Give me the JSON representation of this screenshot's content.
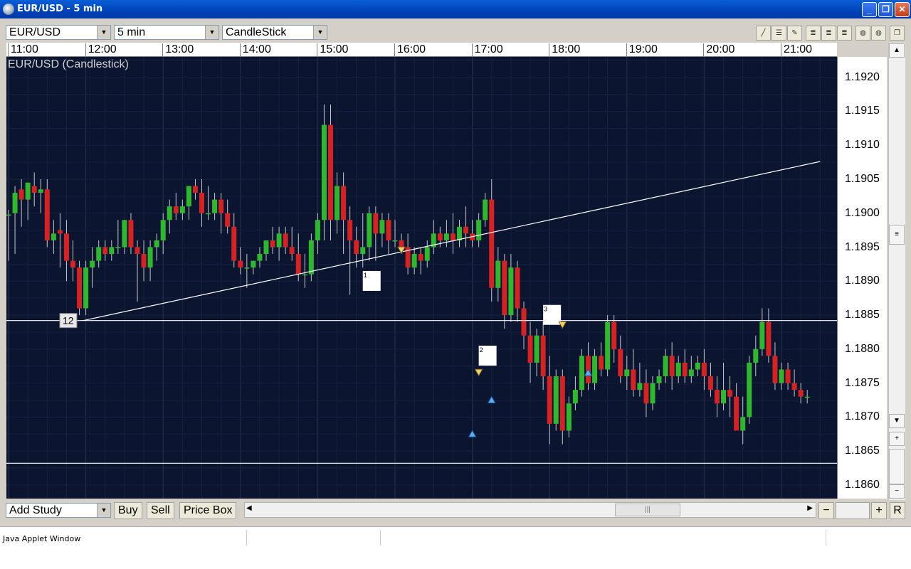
{
  "window": {
    "title": "EUR/USD - 5 min"
  },
  "toolbar": {
    "symbol": "EUR/USD",
    "interval": "5 min",
    "chart_type": "CandleStick"
  },
  "chart": {
    "label": "EUR/USD (Candlestick)",
    "time_labels": [
      "11:00",
      "12:00",
      "13:00",
      "14:00",
      "15:00",
      "16:00",
      "17:00",
      "18:00",
      "19:00",
      "20:00",
      "21:00"
    ],
    "price_labels": [
      "1.1920",
      "1.1915",
      "1.1910",
      "1.1905",
      "1.1900",
      "1.1895",
      "1.1890",
      "1.1885",
      "1.1880",
      "1.1875",
      "1.1870",
      "1.1865",
      "1.1860"
    ],
    "horizontal_levels": [
      1.18842,
      1.18632
    ],
    "trendline": {
      "start_time": "11:58",
      "start_price": 1.18842,
      "end_time": "21:30",
      "end_price": 1.19076
    },
    "level_tag": "12",
    "annotations": [
      {
        "label": "1",
        "time": "15:35",
        "price": 1.18915
      },
      {
        "label": "2",
        "time": "17:05",
        "price": 1.18805
      },
      {
        "label": "3",
        "time": "17:55",
        "price": 1.18865
      }
    ],
    "colors": {
      "background": "#0b1530",
      "up": "#2eb82e",
      "down": "#d62222",
      "line": "#ffffff",
      "sell_marker": "#f2d36b",
      "buy_marker": "#5ab0ff"
    }
  },
  "chart_data": {
    "type": "candlestick",
    "title": "EUR/USD (Candlestick)",
    "interval": "5 min",
    "x_range": [
      "11:00",
      "21:30"
    ],
    "ylim": [
      1.1858,
      1.1923
    ],
    "grid": true,
    "bars": [
      {
        "t": "11:00",
        "o": 1.18998,
        "h": 1.19005,
        "c": 1.18998,
        "l": 1.1893
      },
      {
        "t": "11:05",
        "o": 1.19,
        "h": 1.1904,
        "c": 1.1903,
        "l": 1.1894
      },
      {
        "t": "11:10",
        "o": 1.19035,
        "h": 1.1905,
        "c": 1.1902,
        "l": 1.1898
      },
      {
        "t": "11:15",
        "o": 1.1902,
        "h": 1.19045,
        "c": 1.19045,
        "l": 1.1899
      },
      {
        "t": "11:20",
        "o": 1.1904,
        "h": 1.1906,
        "c": 1.1903,
        "l": 1.1901
      },
      {
        "t": "11:25",
        "o": 1.1903,
        "h": 1.1905,
        "c": 1.19035,
        "l": 1.19
      },
      {
        "t": "11:30",
        "o": 1.19035,
        "h": 1.1905,
        "c": 1.1896,
        "l": 1.1895
      },
      {
        "t": "11:35",
        "o": 1.1896,
        "h": 1.1899,
        "c": 1.1897,
        "l": 1.1894
      },
      {
        "t": "11:40",
        "o": 1.18975,
        "h": 1.19,
        "c": 1.1897,
        "l": 1.1892
      },
      {
        "t": "11:45",
        "o": 1.1897,
        "h": 1.1899,
        "c": 1.1893,
        "l": 1.189
      },
      {
        "t": "11:50",
        "o": 1.1893,
        "h": 1.1896,
        "c": 1.1892,
        "l": 1.189
      },
      {
        "t": "11:55",
        "o": 1.1892,
        "h": 1.1893,
        "c": 1.1886,
        "l": 1.1885
      },
      {
        "t": "12:00",
        "o": 1.1886,
        "h": 1.1893,
        "c": 1.1892,
        "l": 1.1885
      },
      {
        "t": "12:05",
        "o": 1.1892,
        "h": 1.1895,
        "c": 1.1893,
        "l": 1.1889
      },
      {
        "t": "12:10",
        "o": 1.1893,
        "h": 1.1896,
        "c": 1.1895,
        "l": 1.1892
      },
      {
        "t": "12:15",
        "o": 1.1895,
        "h": 1.1896,
        "c": 1.1894,
        "l": 1.1893
      },
      {
        "t": "12:20",
        "o": 1.1894,
        "h": 1.1896,
        "c": 1.1895,
        "l": 1.1893
      },
      {
        "t": "12:25",
        "o": 1.1895,
        "h": 1.1899,
        "c": 1.1895,
        "l": 1.1894
      },
      {
        "t": "12:30",
        "o": 1.1895,
        "h": 1.1899,
        "c": 1.1899,
        "l": 1.1894
      },
      {
        "t": "12:35",
        "o": 1.1899,
        "h": 1.19,
        "c": 1.1895,
        "l": 1.1894
      },
      {
        "t": "12:40",
        "o": 1.1895,
        "h": 1.1896,
        "c": 1.1894,
        "l": 1.1887
      },
      {
        "t": "12:45",
        "o": 1.1894,
        "h": 1.1896,
        "c": 1.1892,
        "l": 1.189
      },
      {
        "t": "12:50",
        "o": 1.1892,
        "h": 1.1896,
        "c": 1.1895,
        "l": 1.189
      },
      {
        "t": "12:55",
        "o": 1.1895,
        "h": 1.1897,
        "c": 1.1896,
        "l": 1.1893
      },
      {
        "t": "13:00",
        "o": 1.1896,
        "h": 1.19,
        "c": 1.1899,
        "l": 1.1894
      },
      {
        "t": "13:05",
        "o": 1.1899,
        "h": 1.1902,
        "c": 1.1901,
        "l": 1.1897
      },
      {
        "t": "13:10",
        "o": 1.1901,
        "h": 1.1903,
        "c": 1.19,
        "l": 1.1899
      },
      {
        "t": "13:15",
        "o": 1.19,
        "h": 1.1902,
        "c": 1.1901,
        "l": 1.1899
      },
      {
        "t": "13:20",
        "o": 1.1901,
        "h": 1.1904,
        "c": 1.1904,
        "l": 1.1899
      },
      {
        "t": "13:25",
        "o": 1.1904,
        "h": 1.1905,
        "c": 1.1903,
        "l": 1.1902
      },
      {
        "t": "13:30",
        "o": 1.1903,
        "h": 1.1905,
        "c": 1.19,
        "l": 1.1898
      },
      {
        "t": "13:35",
        "o": 1.19,
        "h": 1.1904,
        "c": 1.19,
        "l": 1.1899
      },
      {
        "t": "13:40",
        "o": 1.19,
        "h": 1.1903,
        "c": 1.1902,
        "l": 1.1899
      },
      {
        "t": "13:45",
        "o": 1.1902,
        "h": 1.1903,
        "c": 1.19,
        "l": 1.1897
      },
      {
        "t": "13:50",
        "o": 1.19,
        "h": 1.1902,
        "c": 1.1898,
        "l": 1.1897
      },
      {
        "t": "13:55",
        "o": 1.1898,
        "h": 1.19,
        "c": 1.1893,
        "l": 1.1892
      },
      {
        "t": "14:00",
        "o": 1.1893,
        "h": 1.1895,
        "c": 1.1892,
        "l": 1.1891
      },
      {
        "t": "14:05",
        "o": 1.1892,
        "h": 1.1894,
        "c": 1.1892,
        "l": 1.1889
      },
      {
        "t": "14:10",
        "o": 1.1892,
        "h": 1.1893,
        "c": 1.1893,
        "l": 1.1891
      },
      {
        "t": "14:15",
        "o": 1.1893,
        "h": 1.1895,
        "c": 1.1894,
        "l": 1.1892
      },
      {
        "t": "14:20",
        "o": 1.1894,
        "h": 1.1896,
        "c": 1.1896,
        "l": 1.1893
      },
      {
        "t": "14:25",
        "o": 1.1896,
        "h": 1.1898,
        "c": 1.1895,
        "l": 1.1894
      },
      {
        "t": "14:30",
        "o": 1.1895,
        "h": 1.1898,
        "c": 1.1897,
        "l": 1.1893
      },
      {
        "t": "14:35",
        "o": 1.1897,
        "h": 1.1898,
        "c": 1.1895,
        "l": 1.1894
      },
      {
        "t": "14:40",
        "o": 1.1895,
        "h": 1.1898,
        "c": 1.1894,
        "l": 1.1893
      },
      {
        "t": "14:45",
        "o": 1.1894,
        "h": 1.1897,
        "c": 1.1891,
        "l": 1.189
      },
      {
        "t": "14:50",
        "o": 1.1891,
        "h": 1.1894,
        "c": 1.1891,
        "l": 1.1889
      },
      {
        "t": "14:55",
        "o": 1.1891,
        "h": 1.1897,
        "c": 1.1896,
        "l": 1.189
      },
      {
        "t": "15:00",
        "o": 1.1896,
        "h": 1.19,
        "c": 1.1899,
        "l": 1.1894
      },
      {
        "t": "15:05",
        "o": 1.1899,
        "h": 1.1916,
        "c": 1.1913,
        "l": 1.1896
      },
      {
        "t": "15:10",
        "o": 1.1913,
        "h": 1.1916,
        "c": 1.1899,
        "l": 1.1896
      },
      {
        "t": "15:15",
        "o": 1.1899,
        "h": 1.1906,
        "c": 1.1904,
        "l": 1.1897
      },
      {
        "t": "15:20",
        "o": 1.1904,
        "h": 1.1906,
        "c": 1.1899,
        "l": 1.1894
      },
      {
        "t": "15:25",
        "o": 1.1899,
        "h": 1.1901,
        "c": 1.1896,
        "l": 1.1888
      },
      {
        "t": "15:30",
        "o": 1.1896,
        "h": 1.1898,
        "c": 1.1894,
        "l": 1.1892
      },
      {
        "t": "15:35",
        "o": 1.1894,
        "h": 1.19,
        "c": 1.1895,
        "l": 1.1892
      },
      {
        "t": "15:40",
        "o": 1.1895,
        "h": 1.1901,
        "c": 1.19,
        "l": 1.1893
      },
      {
        "t": "15:45",
        "o": 1.19,
        "h": 1.1901,
        "c": 1.1897,
        "l": 1.1893
      },
      {
        "t": "15:50",
        "o": 1.1897,
        "h": 1.19,
        "c": 1.1899,
        "l": 1.1895
      },
      {
        "t": "15:55",
        "o": 1.1899,
        "h": 1.19,
        "c": 1.1896,
        "l": 1.1894
      },
      {
        "t": "16:00",
        "o": 1.1896,
        "h": 1.1899,
        "c": 1.1896,
        "l": 1.1895
      },
      {
        "t": "16:05",
        "o": 1.1896,
        "h": 1.1897,
        "c": 1.1895,
        "l": 1.1894
      },
      {
        "t": "16:10",
        "o": 1.1895,
        "h": 1.1897,
        "c": 1.1892,
        "l": 1.1891
      },
      {
        "t": "16:15",
        "o": 1.1892,
        "h": 1.1895,
        "c": 1.1894,
        "l": 1.1891
      },
      {
        "t": "16:20",
        "o": 1.1894,
        "h": 1.1895,
        "c": 1.1893,
        "l": 1.1891
      },
      {
        "t": "16:25",
        "o": 1.1893,
        "h": 1.1896,
        "c": 1.1895,
        "l": 1.1892
      },
      {
        "t": "16:30",
        "o": 1.1895,
        "h": 1.1899,
        "c": 1.1897,
        "l": 1.1894
      },
      {
        "t": "16:35",
        "o": 1.1897,
        "h": 1.1898,
        "c": 1.1896,
        "l": 1.1895
      },
      {
        "t": "16:40",
        "o": 1.1896,
        "h": 1.1899,
        "c": 1.1897,
        "l": 1.1895
      },
      {
        "t": "16:45",
        "o": 1.1897,
        "h": 1.19,
        "c": 1.1896,
        "l": 1.1894
      },
      {
        "t": "16:50",
        "o": 1.1896,
        "h": 1.1899,
        "c": 1.1898,
        "l": 1.1895
      },
      {
        "t": "16:55",
        "o": 1.1898,
        "h": 1.1901,
        "c": 1.1897,
        "l": 1.1895
      },
      {
        "t": "17:00",
        "o": 1.1897,
        "h": 1.1899,
        "c": 1.1896,
        "l": 1.1895
      },
      {
        "t": "17:05",
        "o": 1.1896,
        "h": 1.19,
        "c": 1.1899,
        "l": 1.1895
      },
      {
        "t": "17:10",
        "o": 1.1899,
        "h": 1.1903,
        "c": 1.1902,
        "l": 1.1898
      },
      {
        "t": "17:15",
        "o": 1.1902,
        "h": 1.1905,
        "c": 1.1889,
        "l": 1.1887
      },
      {
        "t": "17:20",
        "o": 1.1889,
        "h": 1.1895,
        "c": 1.1893,
        "l": 1.1887
      },
      {
        "t": "17:25",
        "o": 1.1893,
        "h": 1.1894,
        "c": 1.1885,
        "l": 1.1883
      },
      {
        "t": "17:30",
        "o": 1.1885,
        "h": 1.1894,
        "c": 1.1892,
        "l": 1.1884
      },
      {
        "t": "17:35",
        "o": 1.1892,
        "h": 1.1893,
        "c": 1.1886,
        "l": 1.1884
      },
      {
        "t": "17:40",
        "o": 1.1886,
        "h": 1.1887,
        "c": 1.1882,
        "l": 1.188
      },
      {
        "t": "17:45",
        "o": 1.1882,
        "h": 1.1884,
        "c": 1.1878,
        "l": 1.1875
      },
      {
        "t": "17:50",
        "o": 1.1878,
        "h": 1.1883,
        "c": 1.1882,
        "l": 1.1876
      },
      {
        "t": "17:55",
        "o": 1.1882,
        "h": 1.1884,
        "c": 1.1876,
        "l": 1.1874
      },
      {
        "t": "18:00",
        "o": 1.1876,
        "h": 1.1879,
        "c": 1.1869,
        "l": 1.1866
      },
      {
        "t": "18:05",
        "o": 1.1869,
        "h": 1.1877,
        "c": 1.1876,
        "l": 1.1868
      },
      {
        "t": "18:10",
        "o": 1.1876,
        "h": 1.1877,
        "c": 1.1868,
        "l": 1.1866
      },
      {
        "t": "18:15",
        "o": 1.1868,
        "h": 1.1873,
        "c": 1.1872,
        "l": 1.1867
      },
      {
        "t": "18:20",
        "o": 1.1872,
        "h": 1.1876,
        "c": 1.1874,
        "l": 1.1871
      },
      {
        "t": "18:25",
        "o": 1.1874,
        "h": 1.188,
        "c": 1.1879,
        "l": 1.1873
      },
      {
        "t": "18:30",
        "o": 1.1879,
        "h": 1.1881,
        "c": 1.1875,
        "l": 1.1874
      },
      {
        "t": "18:35",
        "o": 1.1875,
        "h": 1.188,
        "c": 1.1879,
        "l": 1.1874
      },
      {
        "t": "18:40",
        "o": 1.1879,
        "h": 1.1881,
        "c": 1.1877,
        "l": 1.1876
      },
      {
        "t": "18:45",
        "o": 1.1877,
        "h": 1.1885,
        "c": 1.1884,
        "l": 1.1876
      },
      {
        "t": "18:50",
        "o": 1.1884,
        "h": 1.1885,
        "c": 1.188,
        "l": 1.1878
      },
      {
        "t": "18:55",
        "o": 1.188,
        "h": 1.1882,
        "c": 1.1876,
        "l": 1.1875
      },
      {
        "t": "19:00",
        "o": 1.1876,
        "h": 1.1879,
        "c": 1.1877,
        "l": 1.1874
      },
      {
        "t": "19:05",
        "o": 1.1877,
        "h": 1.188,
        "c": 1.1874,
        "l": 1.1873
      },
      {
        "t": "19:10",
        "o": 1.1874,
        "h": 1.1878,
        "c": 1.1875,
        "l": 1.1873
      },
      {
        "t": "19:15",
        "o": 1.1875,
        "h": 1.1877,
        "c": 1.1872,
        "l": 1.187
      },
      {
        "t": "19:20",
        "o": 1.1872,
        "h": 1.1876,
        "c": 1.1875,
        "l": 1.1871
      },
      {
        "t": "19:25",
        "o": 1.1875,
        "h": 1.1877,
        "c": 1.1876,
        "l": 1.1874
      },
      {
        "t": "19:30",
        "o": 1.1876,
        "h": 1.188,
        "c": 1.1879,
        "l": 1.1875
      },
      {
        "t": "19:35",
        "o": 1.1879,
        "h": 1.1881,
        "c": 1.1876,
        "l": 1.1874
      },
      {
        "t": "19:40",
        "o": 1.1876,
        "h": 1.1879,
        "c": 1.1878,
        "l": 1.1875
      },
      {
        "t": "19:45",
        "o": 1.1878,
        "h": 1.188,
        "c": 1.1876,
        "l": 1.1875
      },
      {
        "t": "19:50",
        "o": 1.1876,
        "h": 1.1879,
        "c": 1.1877,
        "l": 1.1875
      },
      {
        "t": "19:55",
        "o": 1.1877,
        "h": 1.1879,
        "c": 1.1878,
        "l": 1.1876
      },
      {
        "t": "20:00",
        "o": 1.1878,
        "h": 1.188,
        "c": 1.1876,
        "l": 1.1874
      },
      {
        "t": "20:05",
        "o": 1.1876,
        "h": 1.1878,
        "c": 1.1874,
        "l": 1.1873
      },
      {
        "t": "20:10",
        "o": 1.1874,
        "h": 1.1876,
        "c": 1.1872,
        "l": 1.187
      },
      {
        "t": "20:15",
        "o": 1.1872,
        "h": 1.1878,
        "c": 1.1874,
        "l": 1.1871
      },
      {
        "t": "20:20",
        "o": 1.1874,
        "h": 1.1876,
        "c": 1.1873,
        "l": 1.187
      },
      {
        "t": "20:25",
        "o": 1.1873,
        "h": 1.1875,
        "c": 1.1868,
        "l": 1.1868
      },
      {
        "t": "20:30",
        "o": 1.1868,
        "h": 1.1873,
        "c": 1.187,
        "l": 1.1866
      },
      {
        "t": "20:35",
        "o": 1.187,
        "h": 1.1879,
        "c": 1.1878,
        "l": 1.1869
      },
      {
        "t": "20:40",
        "o": 1.1878,
        "h": 1.1882,
        "c": 1.188,
        "l": 1.1876
      },
      {
        "t": "20:45",
        "o": 1.188,
        "h": 1.1886,
        "c": 1.1884,
        "l": 1.1879
      },
      {
        "t": "20:50",
        "o": 1.1884,
        "h": 1.1886,
        "c": 1.1879,
        "l": 1.1878
      },
      {
        "t": "20:55",
        "o": 1.1879,
        "h": 1.1881,
        "c": 1.1875,
        "l": 1.1874
      },
      {
        "t": "21:00",
        "o": 1.1875,
        "h": 1.1878,
        "c": 1.1877,
        "l": 1.1874
      },
      {
        "t": "21:05",
        "o": 1.1877,
        "h": 1.1878,
        "c": 1.1875,
        "l": 1.1874
      },
      {
        "t": "21:10",
        "o": 1.1875,
        "h": 1.1877,
        "c": 1.1874,
        "l": 1.1873
      },
      {
        "t": "21:15",
        "o": 1.1874,
        "h": 1.1875,
        "c": 1.1873,
        "l": 1.1872
      },
      {
        "t": "21:20",
        "o": 1.1873,
        "h": 1.1874,
        "c": 1.1873,
        "l": 1.1872
      }
    ],
    "sell_markers": [
      {
        "t": "16:05",
        "price": 1.18945
      },
      {
        "t": "17:05",
        "price": 1.18765
      },
      {
        "t": "18:10",
        "price": 1.18835
      }
    ],
    "buy_markers": [
      {
        "t": "17:00",
        "price": 1.18675
      },
      {
        "t": "17:15",
        "price": 1.18725
      },
      {
        "t": "18:30",
        "price": 1.18765
      }
    ]
  },
  "bottom": {
    "add_study": "Add Study",
    "buy": "Buy",
    "sell": "Sell",
    "price_box": "Price Box",
    "reset": "R"
  },
  "status": {
    "text": "Java Applet Window"
  }
}
